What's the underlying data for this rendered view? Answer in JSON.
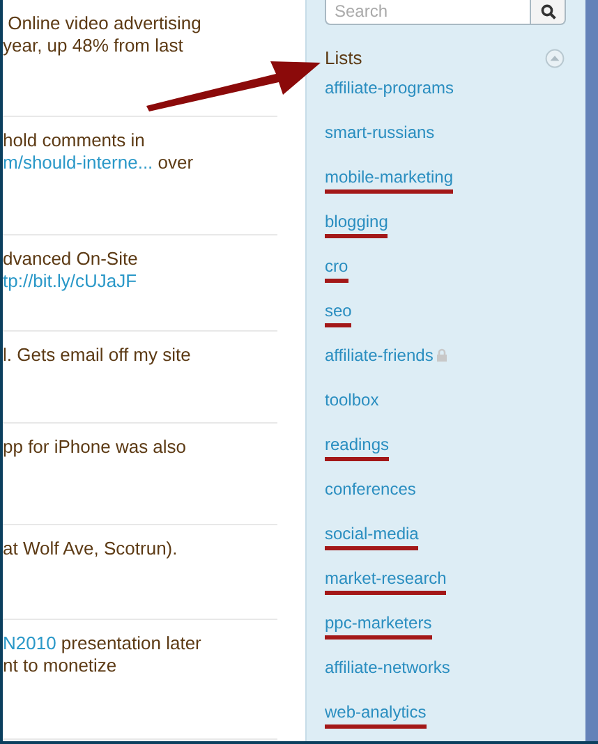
{
  "tweets": [
    {
      "lines": [
        [
          {
            "kind": "text",
            "text": " Online video advertising"
          }
        ],
        [
          {
            "kind": "text",
            "text": "year, up 48% from last"
          }
        ]
      ]
    },
    {
      "lines": [
        [
          {
            "kind": "text",
            "text": "hold comments in"
          }
        ],
        [
          {
            "kind": "link",
            "text": "m/should-interne..."
          },
          {
            "kind": "text",
            "text": " over"
          }
        ]
      ]
    },
    {
      "lines": [
        [
          {
            "kind": "text",
            "text": "dvanced On-Site"
          }
        ],
        [
          {
            "kind": "link",
            "text": "tp://bit.ly/cUJaJF"
          }
        ]
      ]
    },
    {
      "lines": [
        [
          {
            "kind": "text",
            "text": "l. Gets email off my site"
          }
        ]
      ]
    },
    {
      "lines": [
        [
          {
            "kind": "text",
            "text": "pp for iPhone was also"
          }
        ]
      ]
    },
    {
      "lines": [
        [
          {
            "kind": "text",
            "text": "at Wolf Ave, Scotrun)."
          }
        ]
      ]
    },
    {
      "lines": [
        [
          {
            "kind": "link",
            "text": "N2010"
          },
          {
            "kind": "text",
            "text": " presentation later"
          }
        ],
        [
          {
            "kind": "text",
            "text": "nt to monetize"
          }
        ]
      ]
    }
  ],
  "search": {
    "placeholder": "Search"
  },
  "lists": {
    "title": "Lists",
    "expanded": true,
    "items": [
      {
        "label": "affiliate-programs",
        "underlined": false,
        "locked": false
      },
      {
        "label": "smart-russians",
        "underlined": false,
        "locked": false
      },
      {
        "label": "mobile-marketing",
        "underlined": true,
        "locked": false
      },
      {
        "label": "blogging",
        "underlined": true,
        "locked": false
      },
      {
        "label": "cro",
        "underlined": true,
        "locked": false
      },
      {
        "label": "seo",
        "underlined": true,
        "locked": false
      },
      {
        "label": "affiliate-friends",
        "underlined": false,
        "locked": true
      },
      {
        "label": "toolbox",
        "underlined": false,
        "locked": false
      },
      {
        "label": "readings",
        "underlined": true,
        "locked": false
      },
      {
        "label": "conferences",
        "underlined": false,
        "locked": false
      },
      {
        "label": "social-media",
        "underlined": true,
        "locked": false
      },
      {
        "label": "market-research",
        "underlined": true,
        "locked": false
      },
      {
        "label": "ppc-marketers",
        "underlined": true,
        "locked": false
      },
      {
        "label": "affiliate-networks",
        "underlined": false,
        "locked": false
      },
      {
        "label": "web-analytics",
        "underlined": true,
        "locked": false
      }
    ]
  }
}
